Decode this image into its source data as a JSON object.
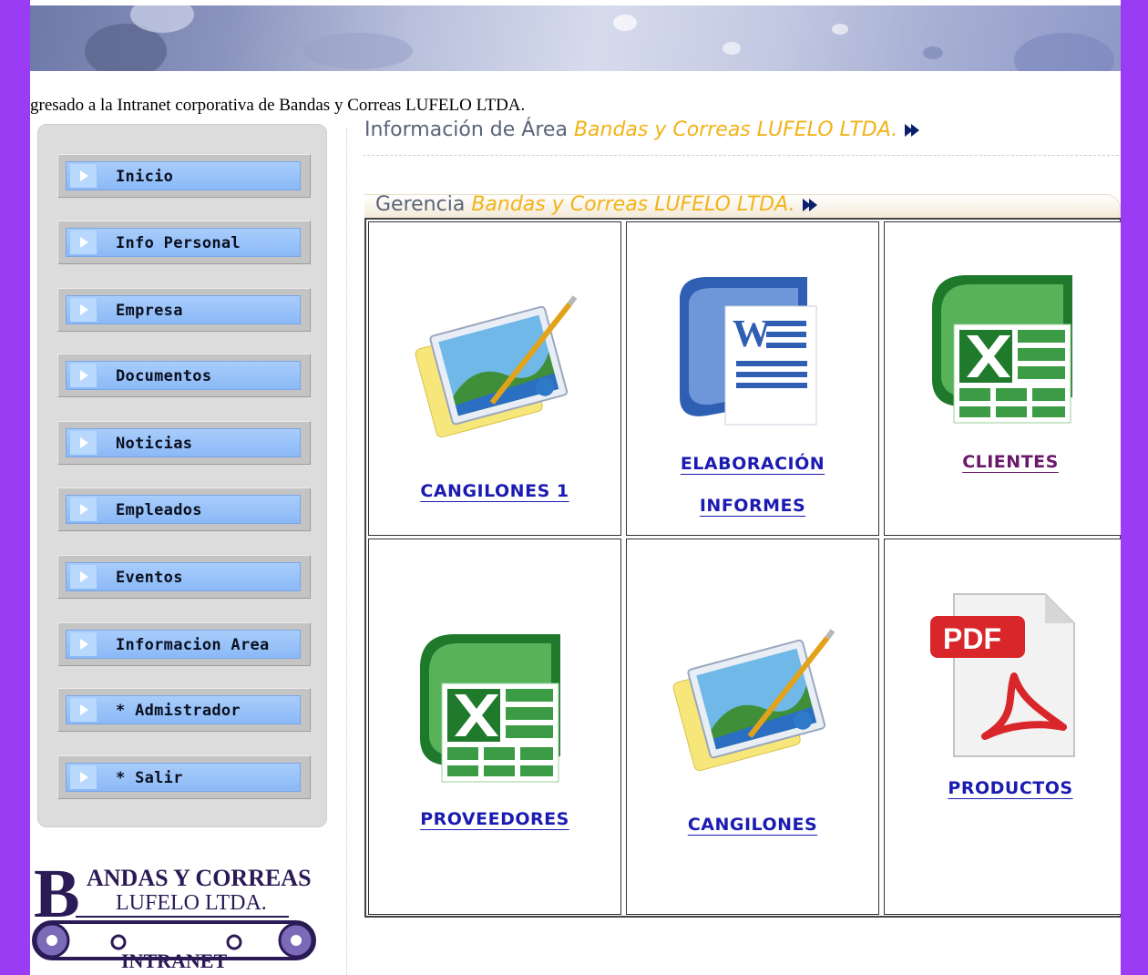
{
  "welcome_text": "gresado a la Intranet corporativa de Bandas y Correas LUFELO LTDA.",
  "area_header": {
    "title": "Información de Área",
    "brand": "Bandas y Correas LUFELO LTDA."
  },
  "section": {
    "title": "Gerencia",
    "brand": "Bandas y Correas LUFELO LTDA."
  },
  "sidebar": {
    "items": [
      {
        "label": "Inicio"
      },
      {
        "label": "Info Personal"
      },
      {
        "label": "Empresa"
      },
      {
        "label": "Documentos"
      },
      {
        "label": "Noticias"
      },
      {
        "label": "Empleados"
      },
      {
        "label": "Eventos"
      },
      {
        "label": "Informacion Area"
      },
      {
        "label": "* Admistrador"
      },
      {
        "label": "* Salir"
      }
    ]
  },
  "logo": {
    "line1": "ANDAS Y CORREAS",
    "initial": "B",
    "line2": "LUFELO LTDA.",
    "line3": "INTRANET"
  },
  "documents": [
    {
      "label": "CANGILONES 1",
      "icon": "image-editor-icon"
    },
    {
      "label_line1": "ELABORACIÓN",
      "label_line2": "INFORMES",
      "icon": "word-document-icon"
    },
    {
      "label": "CLIENTES",
      "icon": "excel-spreadsheet-icon",
      "visited": true
    },
    {
      "label": "PROVEEDORES",
      "icon": "excel-spreadsheet-icon"
    },
    {
      "label": "CANGILONES",
      "icon": "image-editor-icon"
    },
    {
      "label": "PRODUCTOS",
      "icon": "pdf-document-icon"
    }
  ],
  "pdf_badge": "PDF",
  "word_badge": "W",
  "colors": {
    "page_border": "#9b3cf5",
    "brand_yellow": "#f2b318",
    "link_blue": "#1b1bb2",
    "link_visited": "#6b1a6b",
    "nav_blue": "#8bb9f7"
  }
}
